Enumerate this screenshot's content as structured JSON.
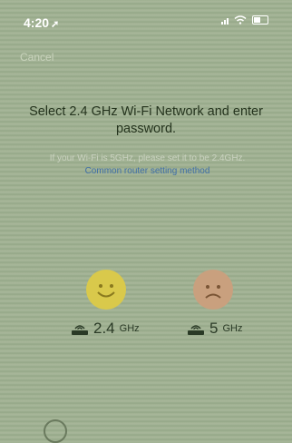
{
  "status_bar": {
    "time": "4:20",
    "arrow": "➚"
  },
  "nav": {
    "cancel_label": "Cancel"
  },
  "content": {
    "title": "Select 2.4 GHz Wi-Fi Network and enter password.",
    "hint_text": "If your Wi-Fi is 5GHz, please set it to be 2.4GHz.",
    "hint_link": "Common router setting method"
  },
  "bands": [
    {
      "value": "2.4",
      "unit": "GHz",
      "status": "supported"
    },
    {
      "value": "5",
      "unit": "GHz",
      "status": "not-supported"
    }
  ],
  "colors": {
    "background": "#9fb091",
    "link": "#3e6ea8",
    "happy": "#d9c94b",
    "sad": "#c9a07e"
  },
  "icons": [
    "happy-face-icon",
    "sad-face-icon",
    "router-icon",
    "wifi-icon",
    "battery-icon",
    "signal-icon"
  ]
}
